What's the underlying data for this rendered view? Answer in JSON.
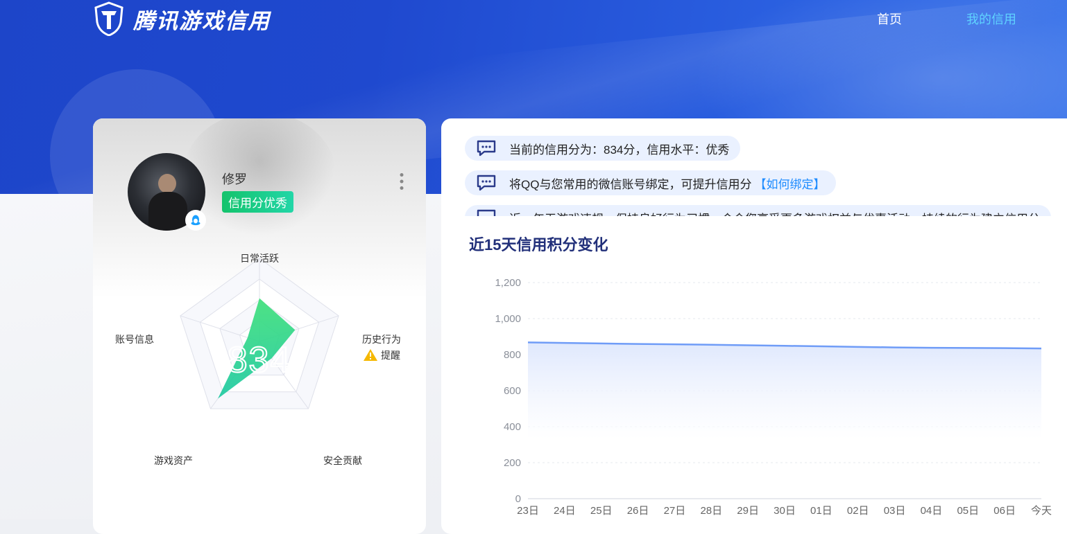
{
  "header": {
    "logo_text": "腾讯游戏信用",
    "nav": [
      {
        "label": "首页"
      },
      {
        "label": "我的信用"
      }
    ]
  },
  "profile": {
    "username": "修罗",
    "badge": "信用分优秀",
    "score": "834"
  },
  "radar": {
    "labels": {
      "daily": "日常活跃",
      "history": "历史行为",
      "security": "安全贡献",
      "assets": "游戏资产",
      "account": "账号信息"
    },
    "history_warning": "提醒",
    "values": {
      "daily": 0.52,
      "history": 0.45,
      "security": 0.25,
      "assets": 0.85,
      "account": 0.15
    }
  },
  "notices": [
    {
      "text": "当前的信用分为：834分，信用水平：优秀",
      "link": ""
    },
    {
      "text": "将QQ与您常用的微信账号绑定，可提升信用分",
      "link": "【如何绑定】"
    },
    {
      "text": "近一年无游戏违规，保持良好行为习惯，会令您享受更多游戏权益与优惠活动，持续的行为建立信用分",
      "link": ""
    }
  ],
  "chart_data": {
    "type": "area",
    "title": "近15天信用积分变化",
    "x": [
      "23日",
      "24日",
      "25日",
      "26日",
      "27日",
      "28日",
      "29日",
      "30日",
      "01日",
      "02日",
      "03日",
      "04日",
      "05日",
      "06日",
      "今天"
    ],
    "series": [
      {
        "values": [
          868,
          865,
          862,
          859,
          857,
          855,
          852,
          849,
          846,
          843,
          840,
          838,
          837,
          836,
          834
        ]
      }
    ],
    "ylim": [
      0,
      1200
    ],
    "yticks": [
      "0",
      "200",
      "400",
      "600",
      "800",
      "1,000",
      "1,200"
    ],
    "ytick_values": [
      0,
      200,
      400,
      600,
      800,
      1000,
      1200
    ],
    "colors": {
      "line": "#6f9cf7",
      "fill": "#dfe8fd"
    }
  }
}
